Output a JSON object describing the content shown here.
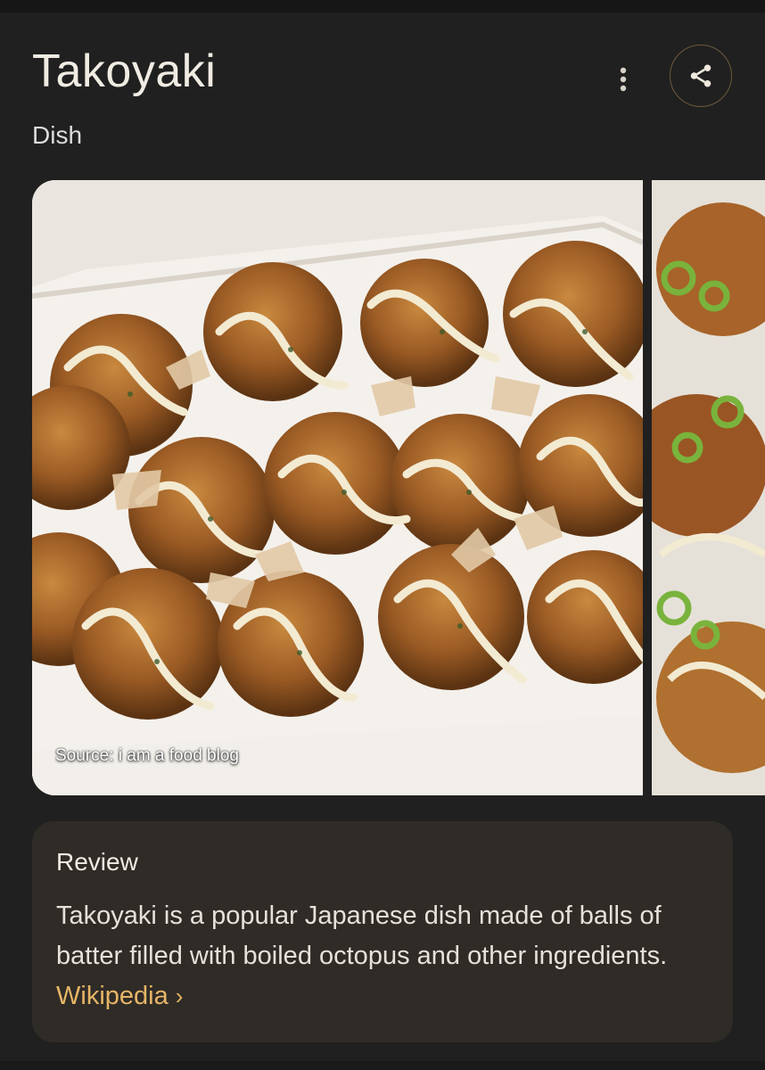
{
  "header": {
    "title": "Takoyaki",
    "subtitle": "Dish"
  },
  "icons": {
    "more": "more-vert-icon",
    "share": "share-icon"
  },
  "image": {
    "source_label": "Source: i am a food blog"
  },
  "review": {
    "heading": "Review",
    "text": "Takoyaki is a popular Japanese dish made of balls of batter filled with boiled octopus and other ingredients.",
    "link_label": "Wikipedia",
    "link_chevron": "›"
  },
  "colors": {
    "background": "#202020",
    "card": "#2f2b27",
    "accent": "#e6b566",
    "share_border": "#6e5a3c"
  }
}
